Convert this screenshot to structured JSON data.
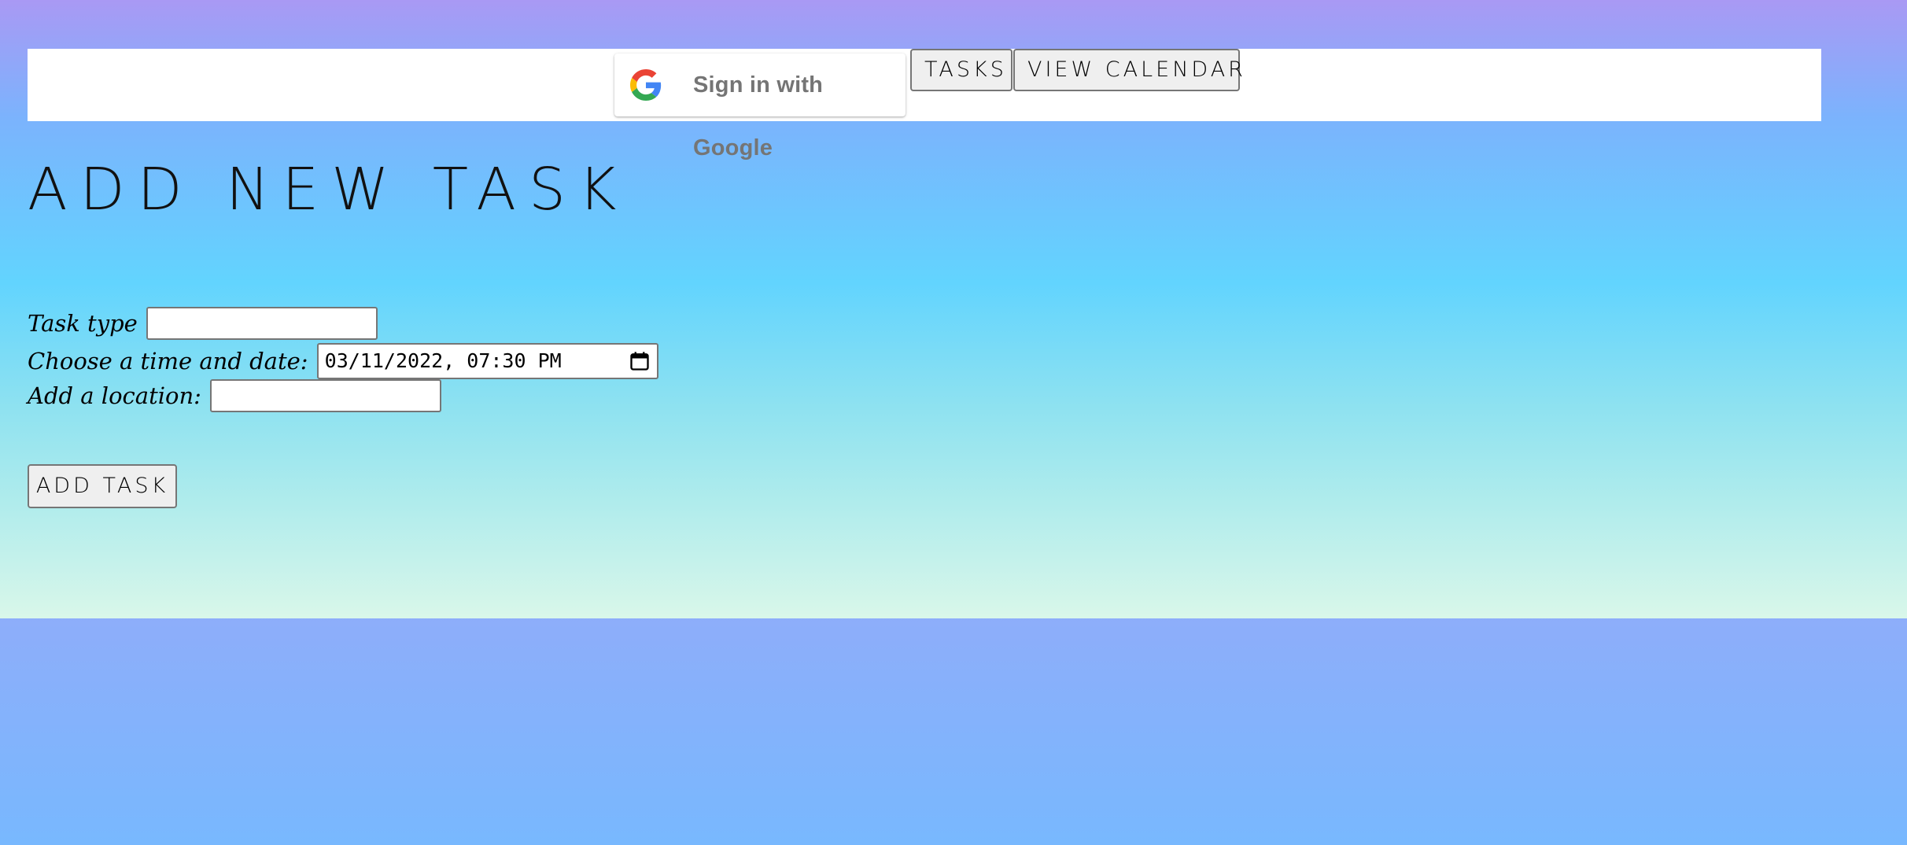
{
  "nav": {
    "google_signin_label": "Sign in with Google",
    "tasks_label": "Tasks",
    "calendar_label": "View Calendar"
  },
  "title": "Add New Task",
  "form": {
    "task_type_label": "Task type",
    "task_type_value": "",
    "datetime_label": "Choose a time and date:",
    "datetime_value": "03/11/2022, 07:30 PM",
    "location_label": "Add a location:",
    "location_value": "",
    "submit_label": "Add Task"
  },
  "icons": {
    "google": "google-g-logo",
    "calendar": "calendar-icon"
  },
  "colors": {
    "nav_background": "#ffffff",
    "google_text": "#757575",
    "gradient_top": "#a999f4",
    "gradient_mid": "#62d4fe",
    "gradient_bottom": "#d9f7ea"
  }
}
